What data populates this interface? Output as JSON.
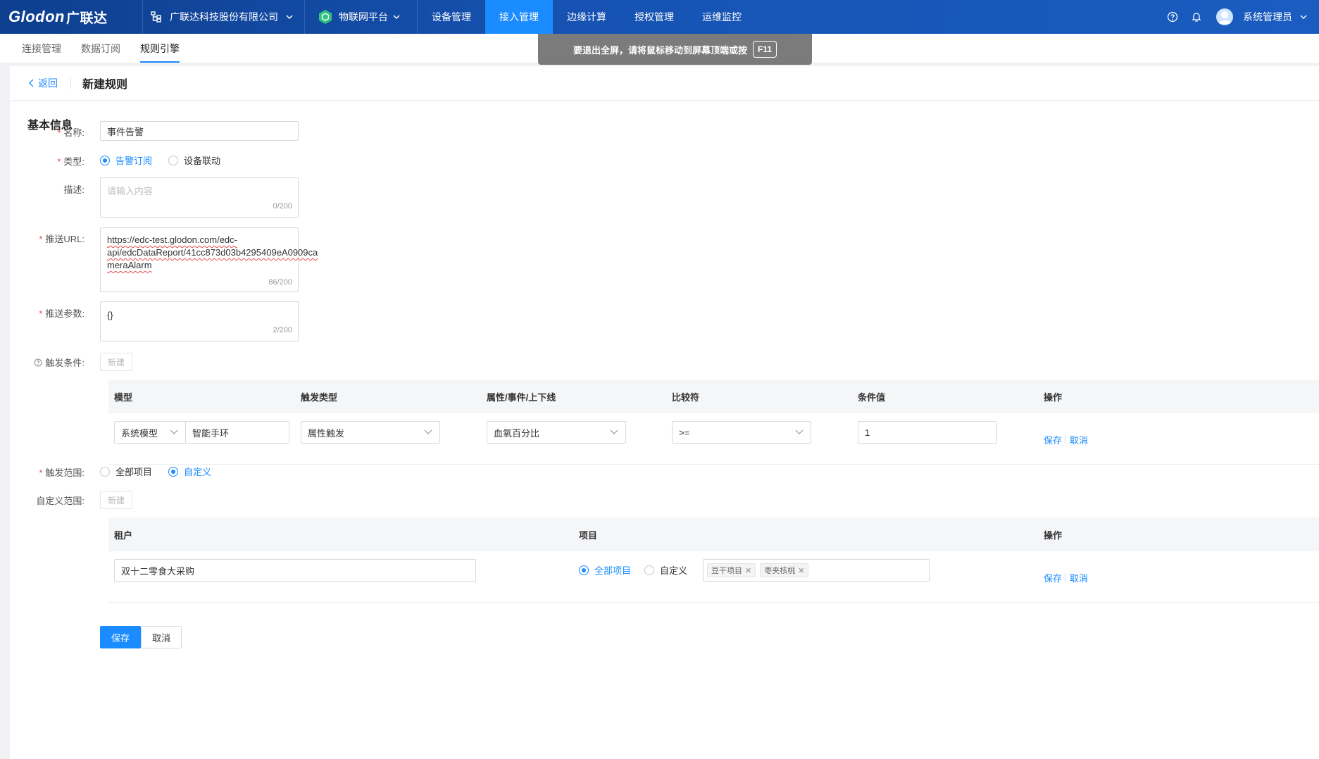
{
  "topbar": {
    "logo_en": "Glodon",
    "logo_cn": "广联达",
    "company": "广联达科技股份有限公司",
    "platform": "物联网平台",
    "nav": [
      "设备管理",
      "接入管理",
      "边缘计算",
      "授权管理",
      "运维监控"
    ],
    "active_nav": "接入管理",
    "username": "系统管理员"
  },
  "toast": {
    "text": "要退出全屏，请将鼠标移动到屏幕顶端或按",
    "key": "F11"
  },
  "subnav": {
    "tabs": [
      "连接管理",
      "数据订阅",
      "规则引擎"
    ],
    "active": "规则引擎"
  },
  "header": {
    "back": "返回",
    "title": "新建规则"
  },
  "basic": {
    "section_title": "基本信息",
    "name_label": "名称:",
    "name_value": "事件告警",
    "type_label": "类型:",
    "type_options": [
      "告警订阅",
      "设备联动"
    ],
    "type_selected": "告警订阅",
    "desc_label": "描述:",
    "desc_placeholder": "请输入内容",
    "desc_count": "0/200",
    "url_label": "推送URL:",
    "url_lines": [
      "https://edc-test.glodon.com/edc-",
      "api/edcDataReport/41cc873d03b4295409eA0909ca",
      "meraAlarm"
    ],
    "url_count": "86/200",
    "params_label": "推送参数:",
    "params_value": "{}",
    "params_count": "2/200",
    "trigger_label": "触发条件:",
    "new_label": "新建"
  },
  "trigger_table": {
    "headers": [
      "模型",
      "触发类型",
      "属性/事件/上下线",
      "比较符",
      "条件值",
      "操作"
    ],
    "row": {
      "model_type": "系统模型",
      "model_name": "智能手环",
      "trigger_type": "属性触发",
      "property": "血氧百分比",
      "comparator": ">=",
      "value": "1",
      "save": "保存",
      "cancel": "取消"
    }
  },
  "scope": {
    "label": "触发范围:",
    "options": [
      "全部项目",
      "自定义"
    ],
    "selected": "自定义",
    "custom_label": "自定义范围:",
    "new_label": "新建"
  },
  "scope_table": {
    "headers": [
      "租户",
      "项目",
      "操作"
    ],
    "row": {
      "tenant": "双十二零食大采购",
      "project_options": [
        "全部项目",
        "自定义"
      ],
      "project_selected": "全部项目",
      "tags": [
        "豆干项目",
        "枣夹核桃"
      ],
      "save": "保存",
      "cancel": "取消"
    }
  },
  "footer": {
    "save": "保存",
    "cancel": "取消"
  },
  "colors": {
    "primary": "#1a8cff",
    "nav_bg": "#1653b3",
    "required": "#e84a4a"
  }
}
